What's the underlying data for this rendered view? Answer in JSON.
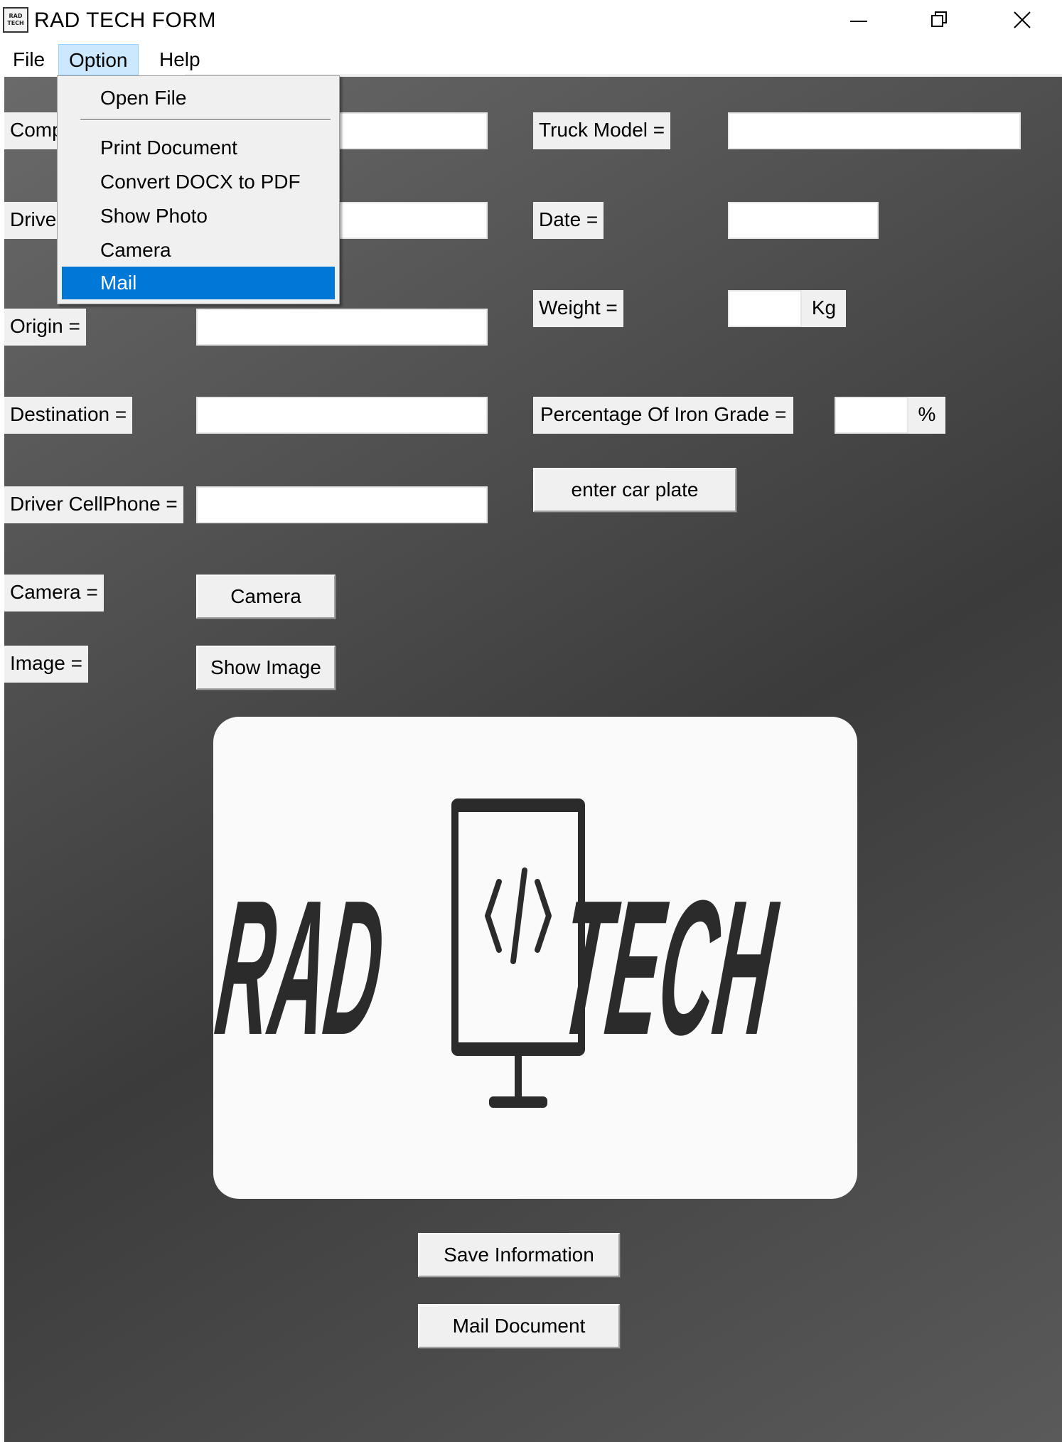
{
  "window": {
    "title": "RAD TECH FORM",
    "icon_text": "RAD TECH"
  },
  "menubar": {
    "items": [
      {
        "label": "File"
      },
      {
        "label": "Option"
      },
      {
        "label": "Help"
      }
    ]
  },
  "dropdown": {
    "items": [
      {
        "label": "Open File"
      },
      {
        "label": "Print Document"
      },
      {
        "label": "Convert DOCX to PDF"
      },
      {
        "label": "Show Photo"
      },
      {
        "label": "Camera"
      },
      {
        "label": "Mail"
      }
    ],
    "selected": "Mail"
  },
  "form": {
    "company_label_visible": "Comp",
    "driver_label_visible": "Drive",
    "origin_label": "Origin =",
    "destination_label": "Destination =",
    "cellphone_label": "Driver CellPhone =",
    "camera_label": "Camera =",
    "image_label": "Image =",
    "truck_model_label": "Truck Model =",
    "date_label": "Date =",
    "weight_label": "Weight =",
    "weight_unit": "Kg",
    "iron_grade_label": "Percentage Of Iron Grade =",
    "iron_grade_unit": "%",
    "fields": {
      "company": "",
      "driver": "",
      "origin": "",
      "destination": "",
      "cellphone": "",
      "truck_model": "",
      "date": "",
      "weight": "",
      "iron_grade": ""
    }
  },
  "buttons": {
    "enter_car_plate": "enter car plate",
    "camera": "Camera",
    "show_image": "Show Image",
    "save_information": "Save Information",
    "mail_document": "Mail Document"
  },
  "logo": {
    "left_text": "RAD",
    "right_text": "TECH"
  },
  "colors": {
    "selection": "#0078d7",
    "menu_active": "#cce8ff",
    "logo_dark": "#2b2b2b"
  }
}
